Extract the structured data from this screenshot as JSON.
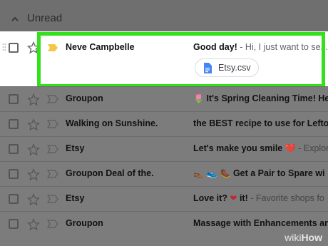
{
  "section": {
    "title": "Unread"
  },
  "selected_email": {
    "sender": "Neve Campbelle",
    "subject": "Good day!",
    "snippet": " - Hi, I just want to se...",
    "attachment": "Etsy.csv"
  },
  "emails": [
    {
      "sender": "Groupon",
      "emoji": "🌷",
      "subject": "It's Spring Cleaning Time! Her",
      "snippet": ""
    },
    {
      "sender": "Walking on Sunshine.",
      "emoji": "",
      "subject": "the BEST recipe to use for Leftov",
      "snippet": ""
    },
    {
      "sender": "Etsy",
      "emoji": "",
      "subject": "Let's make you smile ",
      "emoji2": "💔",
      "snippet": " - Explor"
    },
    {
      "sender": "Groupon Deal of the.",
      "emoji": "👞 👟 🥾",
      "subject": "Get a Pair to Spare wi",
      "snippet": ""
    },
    {
      "sender": "Etsy",
      "emoji": "",
      "subject": "Love it? ",
      "emoji2": "❤",
      "subject2": " it!",
      "snippet": " - Favorite shops fo"
    },
    {
      "sender": "Groupon",
      "emoji": "",
      "subject": "Massage with Enhancements and",
      "snippet": ""
    }
  ],
  "watermark": {
    "prefix": "wiki",
    "suffix": "How"
  },
  "colors": {
    "highlight_border": "#32e01b",
    "important_marker": "#f2c744"
  }
}
